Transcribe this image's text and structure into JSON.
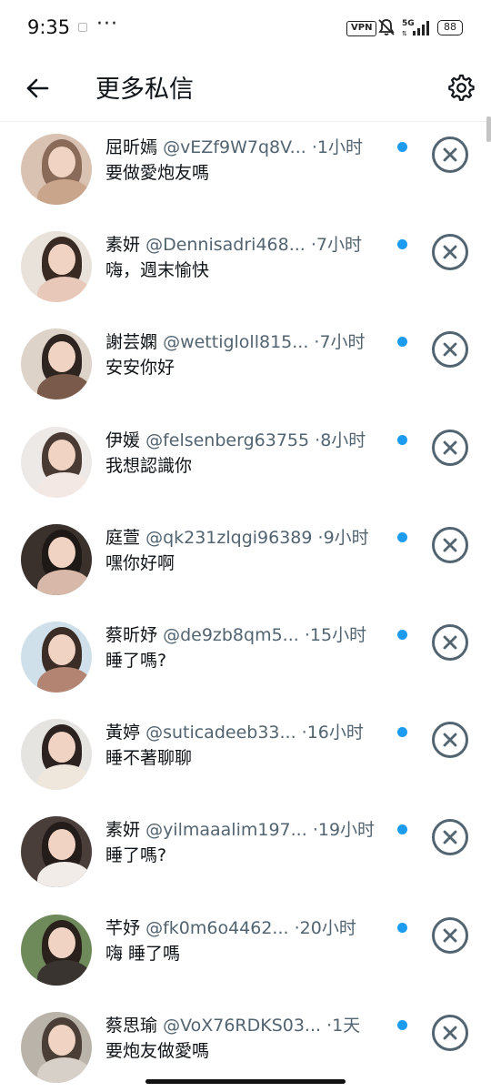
{
  "status_bar": {
    "time": "9:35",
    "dots": "···",
    "vpn": "VPN",
    "network": "5G",
    "battery": "88"
  },
  "header": {
    "title": "更多私信",
    "back_icon": "arrow-left-icon",
    "settings_icon": "gear-icon"
  },
  "colors": {
    "unread": "#1d9bf0",
    "secondary_text": "#536471",
    "primary_text": "#0f1419"
  },
  "messages": [
    {
      "name": "屈昕嫣",
      "handle": "@vEZf9W7q8V...",
      "time": "1小时",
      "preview": "要做愛炮友嗎"
    },
    {
      "name": "素妍",
      "handle": "@Dennisadri468...",
      "time": "7小时",
      "preview": "嗨，週末愉快"
    },
    {
      "name": "謝芸嫻",
      "handle": "@wettigloll815...",
      "time": "7小时",
      "preview": "安安你好"
    },
    {
      "name": "伊媛",
      "handle": "@felsenberg63755",
      "time": "8小时",
      "preview": "我想認識你"
    },
    {
      "name": "庭萱",
      "handle": "@qk231zlqgi96389",
      "time": "9小时",
      "preview": "嘿你好啊"
    },
    {
      "name": "蔡昕妤",
      "handle": "@de9zb8qm5...",
      "time": "15小时",
      "preview": "睡了嗎?"
    },
    {
      "name": "黃婷",
      "handle": "@suticadeeb33...",
      "time": "16小时",
      "preview": "睡不著聊聊"
    },
    {
      "name": "素妍",
      "handle": "@yilmaaalim197...",
      "time": "19小时",
      "preview": "睡了嗎?"
    },
    {
      "name": "芊妤",
      "handle": "@fk0m6o4462...",
      "time": "20小时",
      "preview": "嗨 睡了嗎"
    },
    {
      "name": "蔡思瑜",
      "handle": "@VoX76RDKS03...",
      "time": "1天",
      "preview": "要炮友做愛嗎"
    }
  ]
}
